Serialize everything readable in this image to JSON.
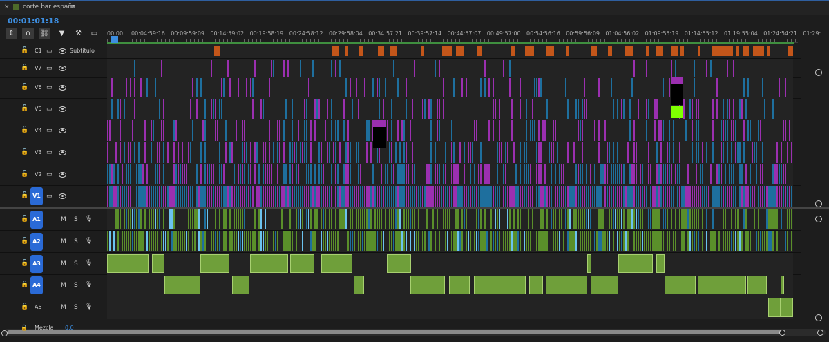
{
  "sequence": {
    "close_symbol": "×",
    "name": "corte bar españa",
    "menu_symbol": "≡",
    "timecode": "00:01:01:18"
  },
  "ruler": [
    "00:00",
    "00:04:59:16",
    "00:09:59:09",
    "00:14:59:02",
    "00:19:58:19",
    "00:24:58:12",
    "00:29:58:04",
    "00:34:57:21",
    "00:39:57:14",
    "00:44:57:07",
    "00:49:57:00",
    "00:54:56:16",
    "00:59:56:09",
    "01:04:56:02",
    "01:09:55:19",
    "01:14:55:12",
    "01:19:55:04",
    "01:24:54:21",
    "01:29:"
  ],
  "caption_track": {
    "name": "C1",
    "label": "Subtítulo"
  },
  "video_tracks": [
    "V7",
    "V6",
    "V5",
    "V4",
    "V3",
    "V2",
    "V1"
  ],
  "audio_tracks": [
    "A1",
    "A2",
    "A3",
    "A4",
    "A5"
  ],
  "mute_label": "M",
  "solo_label": "S",
  "mix": {
    "label": "Mezcla",
    "value": "0,0"
  },
  "colors": {
    "accent": "#2a6ad6",
    "timecode": "#3d8ee0",
    "video_pink": "#9b2fb0",
    "video_blue": "#1e6f9e",
    "audio_green": "#5a8f2a",
    "caption_orange": "#c4561a",
    "audio_light_blue": "#6cc3ef"
  },
  "icons": [
    "ripple-icon",
    "snap-icon",
    "linked-icon",
    "marker-icon",
    "wrench-icon",
    "captions-icon",
    "lock-icon",
    "eye-icon",
    "mic-icon",
    "sequence-color-icon"
  ]
}
